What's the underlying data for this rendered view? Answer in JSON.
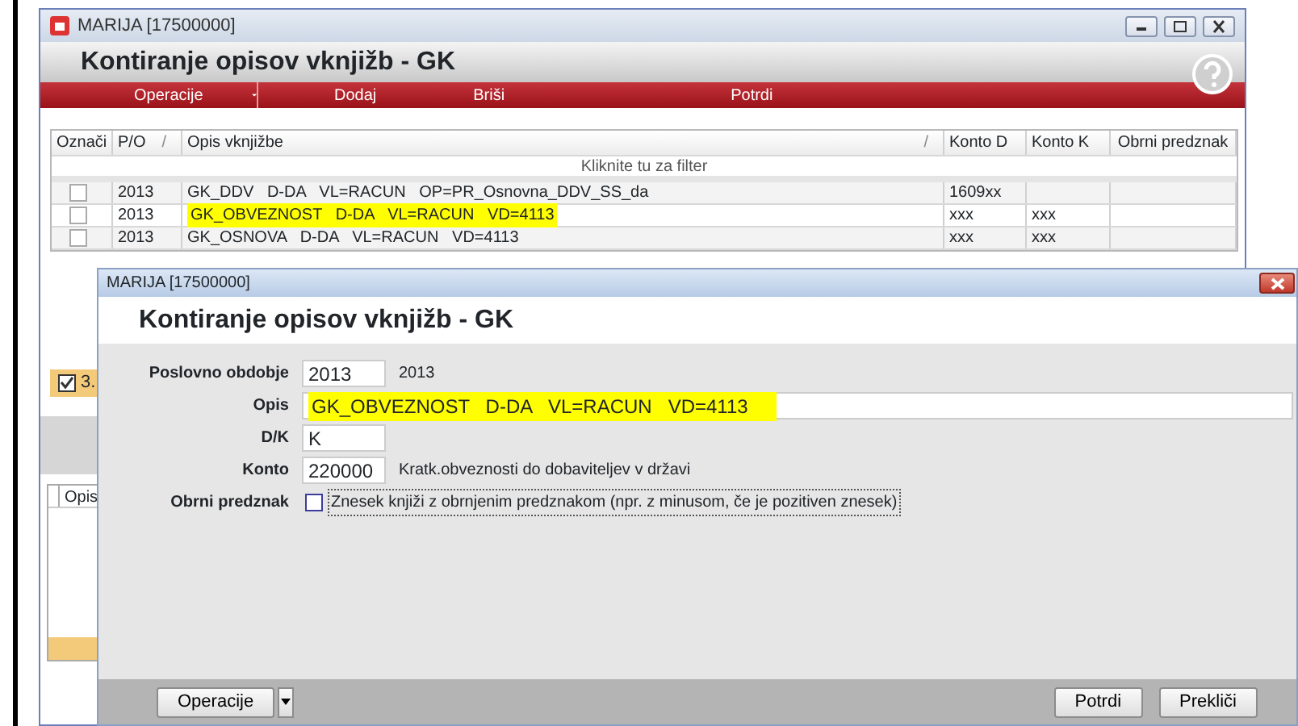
{
  "back_window": {
    "title": "MARIJA [17500000]",
    "heading": "Kontiranje opisov vknjižb - GK",
    "menu": [
      {
        "label": "Operacije",
        "kind": "dropdown"
      },
      {
        "label": "Dodaj",
        "kind": "item"
      },
      {
        "label": "Briši",
        "kind": "item"
      },
      {
        "label": "Potrdi",
        "kind": "item"
      }
    ],
    "table": {
      "columns": [
        {
          "label": "Označi",
          "sortable": false
        },
        {
          "label": "P/O",
          "sortable": true
        },
        {
          "label": "Opis vknjižbe",
          "sortable": true
        },
        {
          "label": "Konto D",
          "sortable": false
        },
        {
          "label": "Konto K",
          "sortable": false
        },
        {
          "label": "Obrni predznak",
          "sortable": false
        }
      ],
      "sort_mark": "/",
      "filter_hint": "Kliknite tu za filter",
      "rows": [
        {
          "checked": false,
          "po": "2013",
          "opis": "GK_DDV   D-DA   VL=RACUN   OP=PR_Osnovna_DDV_SS_da",
          "highlighted": false,
          "konto_d": "1609xx",
          "konto_k": ""
        },
        {
          "checked": false,
          "po": "2013",
          "opis": "GK_OBVEZNOST   D-DA   VL=RACUN   VD=4113",
          "highlighted": true,
          "konto_d": "xxx",
          "konto_k": "xxx"
        },
        {
          "checked": false,
          "po": "2013",
          "opis": "GK_OSNOVA   D-DA   VL=RACUN   VD=4113",
          "highlighted": false,
          "konto_d": "xxx",
          "konto_k": "xxx"
        }
      ]
    },
    "status_count": "3.",
    "lower_column": "Opis"
  },
  "dialog": {
    "title": "MARIJA [17500000]",
    "heading": "Kontiranje opisov vknjižb - GK",
    "fields": [
      {
        "label": "Poslovno obdobje",
        "kind": "short",
        "value": "2013",
        "note": "2013"
      },
      {
        "label": "Opis",
        "kind": "wide",
        "value": "GK_OBVEZNOST   D-DA   VL=RACUN   VD=4113",
        "highlighted": true
      },
      {
        "label": "D/K",
        "kind": "short",
        "value": "K"
      },
      {
        "label": "Konto",
        "kind": "short",
        "value": "220000",
        "note": "Kratk.obveznosti do dobaviteljev v državi"
      },
      {
        "label": "Obrni predznak",
        "kind": "checkbox",
        "checked": false,
        "text": "Znesek knjiži z obrnjenim predznakom (npr. z minusom, če je pozitiven znesek)"
      }
    ],
    "footer": {
      "operations": "Operacije",
      "buttons": [
        "Potrdi",
        "Prekliči"
      ]
    }
  }
}
